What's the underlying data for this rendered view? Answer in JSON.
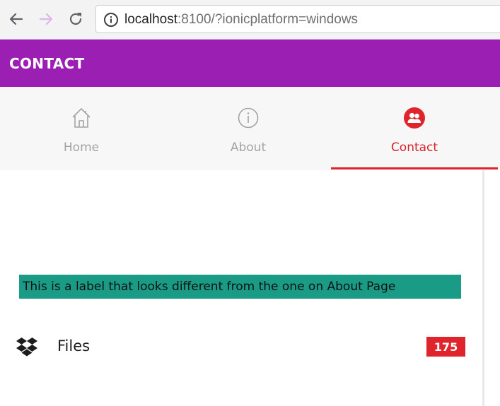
{
  "browser": {
    "url_host": "localhost",
    "url_rest": ":8100/?ionicplatform=windows"
  },
  "toolbar": {
    "title": "CONTACT",
    "color": "#9c1fb3"
  },
  "tabs": [
    {
      "label": "Home",
      "icon": "home-icon",
      "active": false
    },
    {
      "label": "About",
      "icon": "info-icon",
      "active": false
    },
    {
      "label": "Contact",
      "icon": "contacts-icon",
      "active": true
    }
  ],
  "content": {
    "label_text": "This is a label that looks different from the one on About Page",
    "files": {
      "icon": "dropbox-icon",
      "label": "Files",
      "badge": "175"
    }
  },
  "colors": {
    "accent": "#e0242b",
    "label_background": "#1a9b86"
  }
}
